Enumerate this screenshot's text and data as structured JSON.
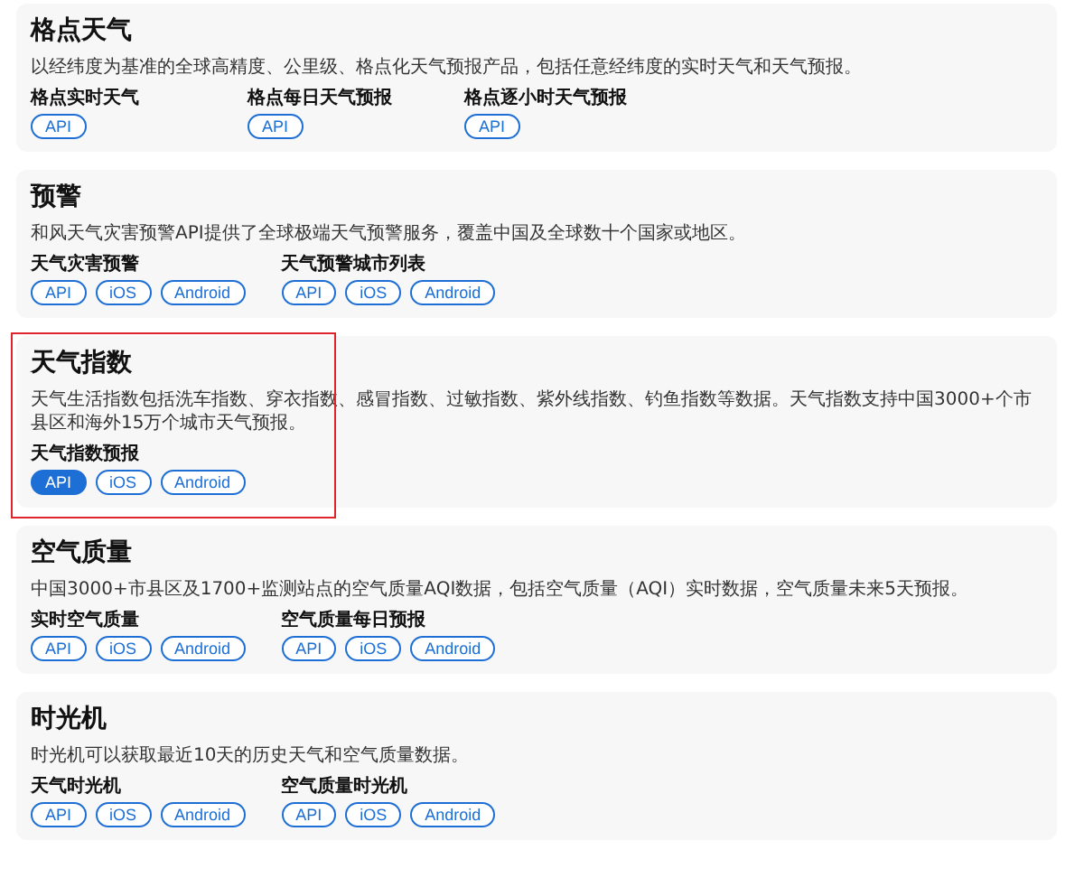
{
  "sections": [
    {
      "title": "格点天气",
      "description": "以经纬度为基准的全球高精度、公里级、格点化天气预报产品，包括任意经纬度的实时天气和天气预报。",
      "highlighted": false,
      "products": [
        {
          "name": "格点实时天气",
          "platforms": [
            {
              "label": "API",
              "selected": false
            }
          ]
        },
        {
          "name": "格点每日天气预报",
          "platforms": [
            {
              "label": "API",
              "selected": false
            }
          ]
        },
        {
          "name": "格点逐小时天气预报",
          "platforms": [
            {
              "label": "API",
              "selected": false
            }
          ]
        }
      ]
    },
    {
      "title": "预警",
      "description": "和风天气灾害预警API提供了全球极端天气预警服务，覆盖中国及全球数十个国家或地区。",
      "highlighted": false,
      "products": [
        {
          "name": "天气灾害预警",
          "platforms": [
            {
              "label": "API",
              "selected": false
            },
            {
              "label": "iOS",
              "selected": false
            },
            {
              "label": "Android",
              "selected": false
            }
          ]
        },
        {
          "name": "天气预警城市列表",
          "platforms": [
            {
              "label": "API",
              "selected": false
            },
            {
              "label": "iOS",
              "selected": false
            },
            {
              "label": "Android",
              "selected": false
            }
          ]
        }
      ]
    },
    {
      "title": "天气指数",
      "description": "天气生活指数包括洗车指数、穿衣指数、感冒指数、过敏指数、紫外线指数、钓鱼指数等数据。天气指数支持中国3000+个市县区和海外15万个城市天气预报。",
      "highlighted": true,
      "products": [
        {
          "name": "天气指数预报",
          "platforms": [
            {
              "label": "API",
              "selected": true
            },
            {
              "label": "iOS",
              "selected": false
            },
            {
              "label": "Android",
              "selected": false
            }
          ]
        }
      ]
    },
    {
      "title": "空气质量",
      "description": "中国3000+市县区及1700+监测站点的空气质量AQI数据，包括空气质量（AQI）实时数据，空气质量未来5天预报。",
      "highlighted": false,
      "products": [
        {
          "name": "实时空气质量",
          "platforms": [
            {
              "label": "API",
              "selected": false
            },
            {
              "label": "iOS",
              "selected": false
            },
            {
              "label": "Android",
              "selected": false
            }
          ]
        },
        {
          "name": "空气质量每日预报",
          "platforms": [
            {
              "label": "API",
              "selected": false
            },
            {
              "label": "iOS",
              "selected": false
            },
            {
              "label": "Android",
              "selected": false
            }
          ]
        }
      ]
    },
    {
      "title": "时光机",
      "description": "时光机可以获取最近10天的历史天气和空气质量数据。",
      "highlighted": false,
      "products": [
        {
          "name": "天气时光机",
          "platforms": [
            {
              "label": "API",
              "selected": false
            },
            {
              "label": "iOS",
              "selected": false
            },
            {
              "label": "Android",
              "selected": false
            }
          ]
        },
        {
          "name": "空气质量时光机",
          "platforms": [
            {
              "label": "API",
              "selected": false
            },
            {
              "label": "iOS",
              "selected": false
            },
            {
              "label": "Android",
              "selected": false
            }
          ]
        }
      ]
    }
  ]
}
